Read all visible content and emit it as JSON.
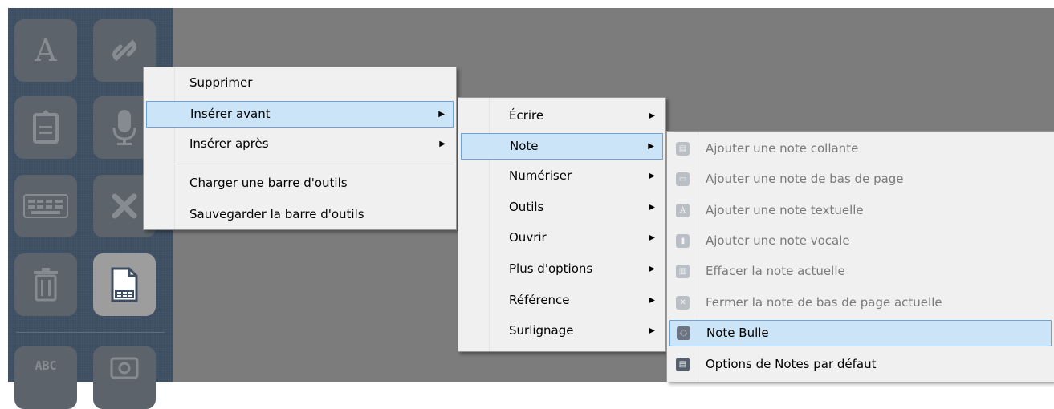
{
  "toolbar_panel": {
    "text_tool_label": "A",
    "abbr_tool_label": "ABC"
  },
  "menu1": {
    "items": [
      "Supprimer",
      "Insérer avant",
      "Insérer après",
      "Charger une barre d'outils",
      "Sauvegarder la barre d'outils"
    ]
  },
  "menu2": {
    "items": [
      "Écrire",
      "Note",
      "Numériser",
      "Outils",
      "Ouvrir",
      "Plus d'options",
      "Référence",
      "Surlignage"
    ]
  },
  "menu3": {
    "items": [
      "Ajouter une note collante",
      "Ajouter une note de bas de page",
      "Ajouter une note textuelle",
      "Ajouter une note vocale",
      "Effacer la note actuelle",
      "Fermer la note de bas de page actuelle",
      "Note Bulle",
      "Options de Notes par défaut"
    ],
    "icons": [
      "sticky-note-icon",
      "footnote-icon",
      "text-note-icon",
      "voice-note-icon",
      "erase-note-icon",
      "close-footnote-icon",
      "bubble-note-icon",
      "note-options-icon"
    ]
  },
  "submenu_arrow": "▶",
  "colors": {
    "highlight": "#cce4f7",
    "highlight_border": "#6ea3d8",
    "panel": "#3c4d61",
    "background": "#7c7c7c",
    "disabled_text": "#7a7a7a"
  }
}
